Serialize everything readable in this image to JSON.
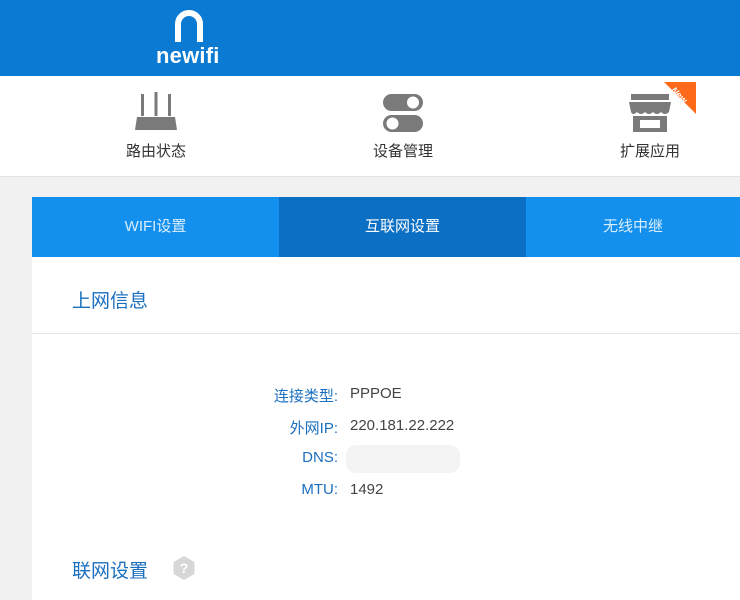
{
  "header": {
    "brand": "newifi"
  },
  "nav": {
    "items": [
      {
        "label": "路由状态",
        "icon": "router-icon"
      },
      {
        "label": "设备管理",
        "icon": "toggle-switches-icon"
      },
      {
        "label": "扩展应用",
        "icon": "shop-icon",
        "badge": "New"
      }
    ]
  },
  "tabs": [
    {
      "label": "WIFI设置",
      "active": false
    },
    {
      "label": "互联网设置",
      "active": true
    },
    {
      "label": "无线中继",
      "active": false
    }
  ],
  "sections": {
    "online_info_title": "上网信息",
    "network_settings_title": "联网设置"
  },
  "info": [
    {
      "key": "连接类型:",
      "value": "PPPOE"
    },
    {
      "key": "外网IP:",
      "value": "220.181.22.222"
    },
    {
      "key": "DNS:",
      "value": ""
    },
    {
      "key": "MTU:",
      "value": "1492"
    }
  ],
  "colors": {
    "header": "#0b7ad3",
    "tab_bar": "#1390ee",
    "tab_active": "#0b6fc4",
    "label_blue": "#1b6fbf",
    "badge": "#ff6a1a",
    "icon_gray": "#7a7a7a"
  }
}
